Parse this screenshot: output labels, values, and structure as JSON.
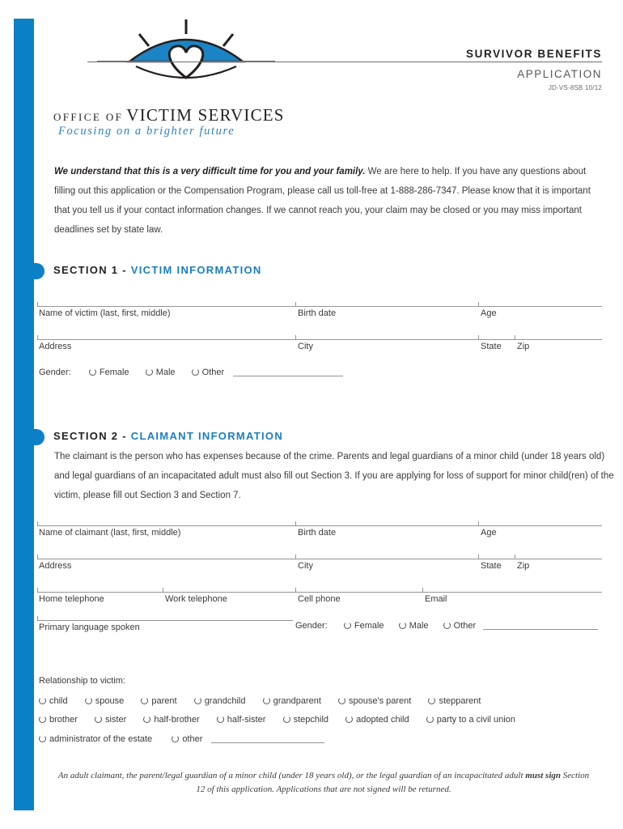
{
  "header": {
    "title": "SURVIVOR BENEFITS",
    "subtitle": "APPLICATION",
    "form_code": "JD-VS-8SB 10/12",
    "org_small": "OFFICE OF",
    "org_big": "VICTIM SERVICES",
    "tagline": "Focusing on a brighter future",
    "logo_icon": "sunrise-heart-eye-logo"
  },
  "intro": {
    "bold_lead": "We understand that this is a very difficult time for you and your family.",
    "rest": " We are here to help. If you have any questions about filling out this application or the Compensation Program, please call us toll-free at 1-888-286-7347. Please know that it is important that you tell us if your contact information changes. If we cannot reach you, your claim may be closed or you may miss important deadlines set by state law."
  },
  "section1": {
    "number": "SECTION 1 - ",
    "title": "VICTIM INFORMATION",
    "fields": {
      "name": "Name of victim (last, first, middle)",
      "birth_date": "Birth date",
      "age": "Age",
      "address": "Address",
      "city": "City",
      "state": "State",
      "zip": "Zip"
    },
    "gender": {
      "label": "Gender:",
      "options": [
        "Female",
        "Male",
        "Other"
      ]
    }
  },
  "section2": {
    "number": "SECTION 2 - ",
    "title": "CLAIMANT INFORMATION",
    "paragraph": "The claimant is the person who has expenses because of the crime. Parents and legal guardians of a minor child (under 18 years old) and legal guardians of an incapacitated adult must also fill out Section 3. If you are applying for loss of support for minor child(ren) of the victim, please fill out Section 3 and Section 7.",
    "fields": {
      "name": "Name of claimant (last, first, middle)",
      "birth_date": "Birth date",
      "age": "Age",
      "address": "Address",
      "city": "City",
      "state": "State",
      "zip": "Zip",
      "home_telephone": "Home telephone",
      "work_telephone": "Work telephone",
      "cell_phone": "Cell phone",
      "email": "Email",
      "primary_language": "Primary language spoken"
    },
    "gender": {
      "label": "Gender:",
      "options": [
        "Female",
        "Male",
        "Other"
      ]
    },
    "relationship": {
      "label": "Relationship to victim:",
      "row1": [
        "child",
        "spouse",
        "parent",
        "grandchild",
        "grandparent",
        "spouse's parent",
        "stepparent"
      ],
      "row2": [
        "brother",
        "sister",
        "half-brother",
        "half-sister",
        "stepchild",
        "adopted child",
        "party to a civil union"
      ],
      "row3": [
        "administrator of the estate",
        "other"
      ]
    }
  },
  "footnote": {
    "line1": "An adult claimant, the parent/legal guardian of a minor child (under 18 years old), or the legal guardian of an incapacitated adult",
    "bold": "must sign",
    "line2_rest": " Section 12 of this application. Applications that are not signed will be returned."
  },
  "colors": {
    "brand_blue": "#0b80c6",
    "heading_blue": "#1a7fc1",
    "rule_gray": "#939598"
  }
}
